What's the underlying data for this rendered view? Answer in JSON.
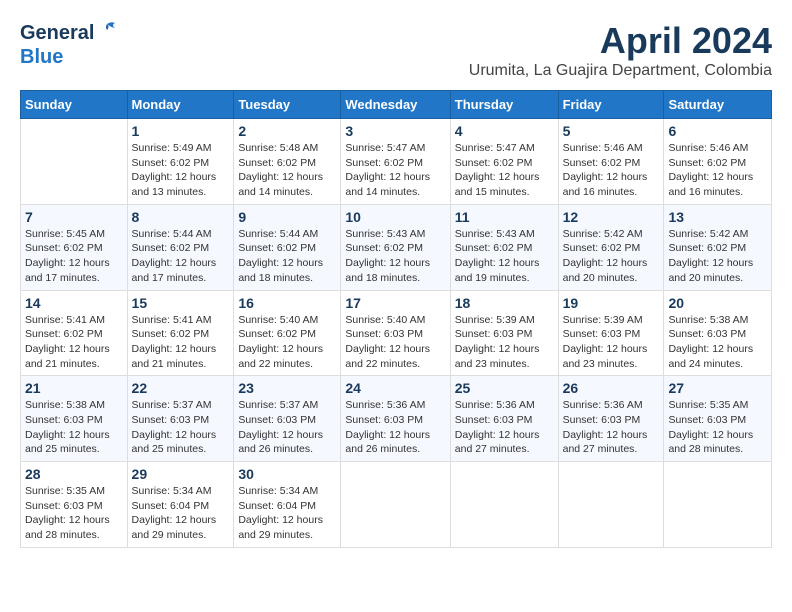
{
  "header": {
    "logo_line1": "General",
    "logo_line2": "Blue",
    "month": "April 2024",
    "location": "Urumita, La Guajira Department, Colombia"
  },
  "days_of_week": [
    "Sunday",
    "Monday",
    "Tuesday",
    "Wednesday",
    "Thursday",
    "Friday",
    "Saturday"
  ],
  "weeks": [
    [
      {
        "day": "",
        "sunrise": "",
        "sunset": "",
        "daylight": ""
      },
      {
        "day": "1",
        "sunrise": "Sunrise: 5:49 AM",
        "sunset": "Sunset: 6:02 PM",
        "daylight": "Daylight: 12 hours and 13 minutes."
      },
      {
        "day": "2",
        "sunrise": "Sunrise: 5:48 AM",
        "sunset": "Sunset: 6:02 PM",
        "daylight": "Daylight: 12 hours and 14 minutes."
      },
      {
        "day": "3",
        "sunrise": "Sunrise: 5:47 AM",
        "sunset": "Sunset: 6:02 PM",
        "daylight": "Daylight: 12 hours and 14 minutes."
      },
      {
        "day": "4",
        "sunrise": "Sunrise: 5:47 AM",
        "sunset": "Sunset: 6:02 PM",
        "daylight": "Daylight: 12 hours and 15 minutes."
      },
      {
        "day": "5",
        "sunrise": "Sunrise: 5:46 AM",
        "sunset": "Sunset: 6:02 PM",
        "daylight": "Daylight: 12 hours and 16 minutes."
      },
      {
        "day": "6",
        "sunrise": "Sunrise: 5:46 AM",
        "sunset": "Sunset: 6:02 PM",
        "daylight": "Daylight: 12 hours and 16 minutes."
      }
    ],
    [
      {
        "day": "7",
        "sunrise": "Sunrise: 5:45 AM",
        "sunset": "Sunset: 6:02 PM",
        "daylight": "Daylight: 12 hours and 17 minutes."
      },
      {
        "day": "8",
        "sunrise": "Sunrise: 5:44 AM",
        "sunset": "Sunset: 6:02 PM",
        "daylight": "Daylight: 12 hours and 17 minutes."
      },
      {
        "day": "9",
        "sunrise": "Sunrise: 5:44 AM",
        "sunset": "Sunset: 6:02 PM",
        "daylight": "Daylight: 12 hours and 18 minutes."
      },
      {
        "day": "10",
        "sunrise": "Sunrise: 5:43 AM",
        "sunset": "Sunset: 6:02 PM",
        "daylight": "Daylight: 12 hours and 18 minutes."
      },
      {
        "day": "11",
        "sunrise": "Sunrise: 5:43 AM",
        "sunset": "Sunset: 6:02 PM",
        "daylight": "Daylight: 12 hours and 19 minutes."
      },
      {
        "day": "12",
        "sunrise": "Sunrise: 5:42 AM",
        "sunset": "Sunset: 6:02 PM",
        "daylight": "Daylight: 12 hours and 20 minutes."
      },
      {
        "day": "13",
        "sunrise": "Sunrise: 5:42 AM",
        "sunset": "Sunset: 6:02 PM",
        "daylight": "Daylight: 12 hours and 20 minutes."
      }
    ],
    [
      {
        "day": "14",
        "sunrise": "Sunrise: 5:41 AM",
        "sunset": "Sunset: 6:02 PM",
        "daylight": "Daylight: 12 hours and 21 minutes."
      },
      {
        "day": "15",
        "sunrise": "Sunrise: 5:41 AM",
        "sunset": "Sunset: 6:02 PM",
        "daylight": "Daylight: 12 hours and 21 minutes."
      },
      {
        "day": "16",
        "sunrise": "Sunrise: 5:40 AM",
        "sunset": "Sunset: 6:02 PM",
        "daylight": "Daylight: 12 hours and 22 minutes."
      },
      {
        "day": "17",
        "sunrise": "Sunrise: 5:40 AM",
        "sunset": "Sunset: 6:03 PM",
        "daylight": "Daylight: 12 hours and 22 minutes."
      },
      {
        "day": "18",
        "sunrise": "Sunrise: 5:39 AM",
        "sunset": "Sunset: 6:03 PM",
        "daylight": "Daylight: 12 hours and 23 minutes."
      },
      {
        "day": "19",
        "sunrise": "Sunrise: 5:39 AM",
        "sunset": "Sunset: 6:03 PM",
        "daylight": "Daylight: 12 hours and 23 minutes."
      },
      {
        "day": "20",
        "sunrise": "Sunrise: 5:38 AM",
        "sunset": "Sunset: 6:03 PM",
        "daylight": "Daylight: 12 hours and 24 minutes."
      }
    ],
    [
      {
        "day": "21",
        "sunrise": "Sunrise: 5:38 AM",
        "sunset": "Sunset: 6:03 PM",
        "daylight": "Daylight: 12 hours and 25 minutes."
      },
      {
        "day": "22",
        "sunrise": "Sunrise: 5:37 AM",
        "sunset": "Sunset: 6:03 PM",
        "daylight": "Daylight: 12 hours and 25 minutes."
      },
      {
        "day": "23",
        "sunrise": "Sunrise: 5:37 AM",
        "sunset": "Sunset: 6:03 PM",
        "daylight": "Daylight: 12 hours and 26 minutes."
      },
      {
        "day": "24",
        "sunrise": "Sunrise: 5:36 AM",
        "sunset": "Sunset: 6:03 PM",
        "daylight": "Daylight: 12 hours and 26 minutes."
      },
      {
        "day": "25",
        "sunrise": "Sunrise: 5:36 AM",
        "sunset": "Sunset: 6:03 PM",
        "daylight": "Daylight: 12 hours and 27 minutes."
      },
      {
        "day": "26",
        "sunrise": "Sunrise: 5:36 AM",
        "sunset": "Sunset: 6:03 PM",
        "daylight": "Daylight: 12 hours and 27 minutes."
      },
      {
        "day": "27",
        "sunrise": "Sunrise: 5:35 AM",
        "sunset": "Sunset: 6:03 PM",
        "daylight": "Daylight: 12 hours and 28 minutes."
      }
    ],
    [
      {
        "day": "28",
        "sunrise": "Sunrise: 5:35 AM",
        "sunset": "Sunset: 6:03 PM",
        "daylight": "Daylight: 12 hours and 28 minutes."
      },
      {
        "day": "29",
        "sunrise": "Sunrise: 5:34 AM",
        "sunset": "Sunset: 6:04 PM",
        "daylight": "Daylight: 12 hours and 29 minutes."
      },
      {
        "day": "30",
        "sunrise": "Sunrise: 5:34 AM",
        "sunset": "Sunset: 6:04 PM",
        "daylight": "Daylight: 12 hours and 29 minutes."
      },
      {
        "day": "",
        "sunrise": "",
        "sunset": "",
        "daylight": ""
      },
      {
        "day": "",
        "sunrise": "",
        "sunset": "",
        "daylight": ""
      },
      {
        "day": "",
        "sunrise": "",
        "sunset": "",
        "daylight": ""
      },
      {
        "day": "",
        "sunrise": "",
        "sunset": "",
        "daylight": ""
      }
    ]
  ]
}
